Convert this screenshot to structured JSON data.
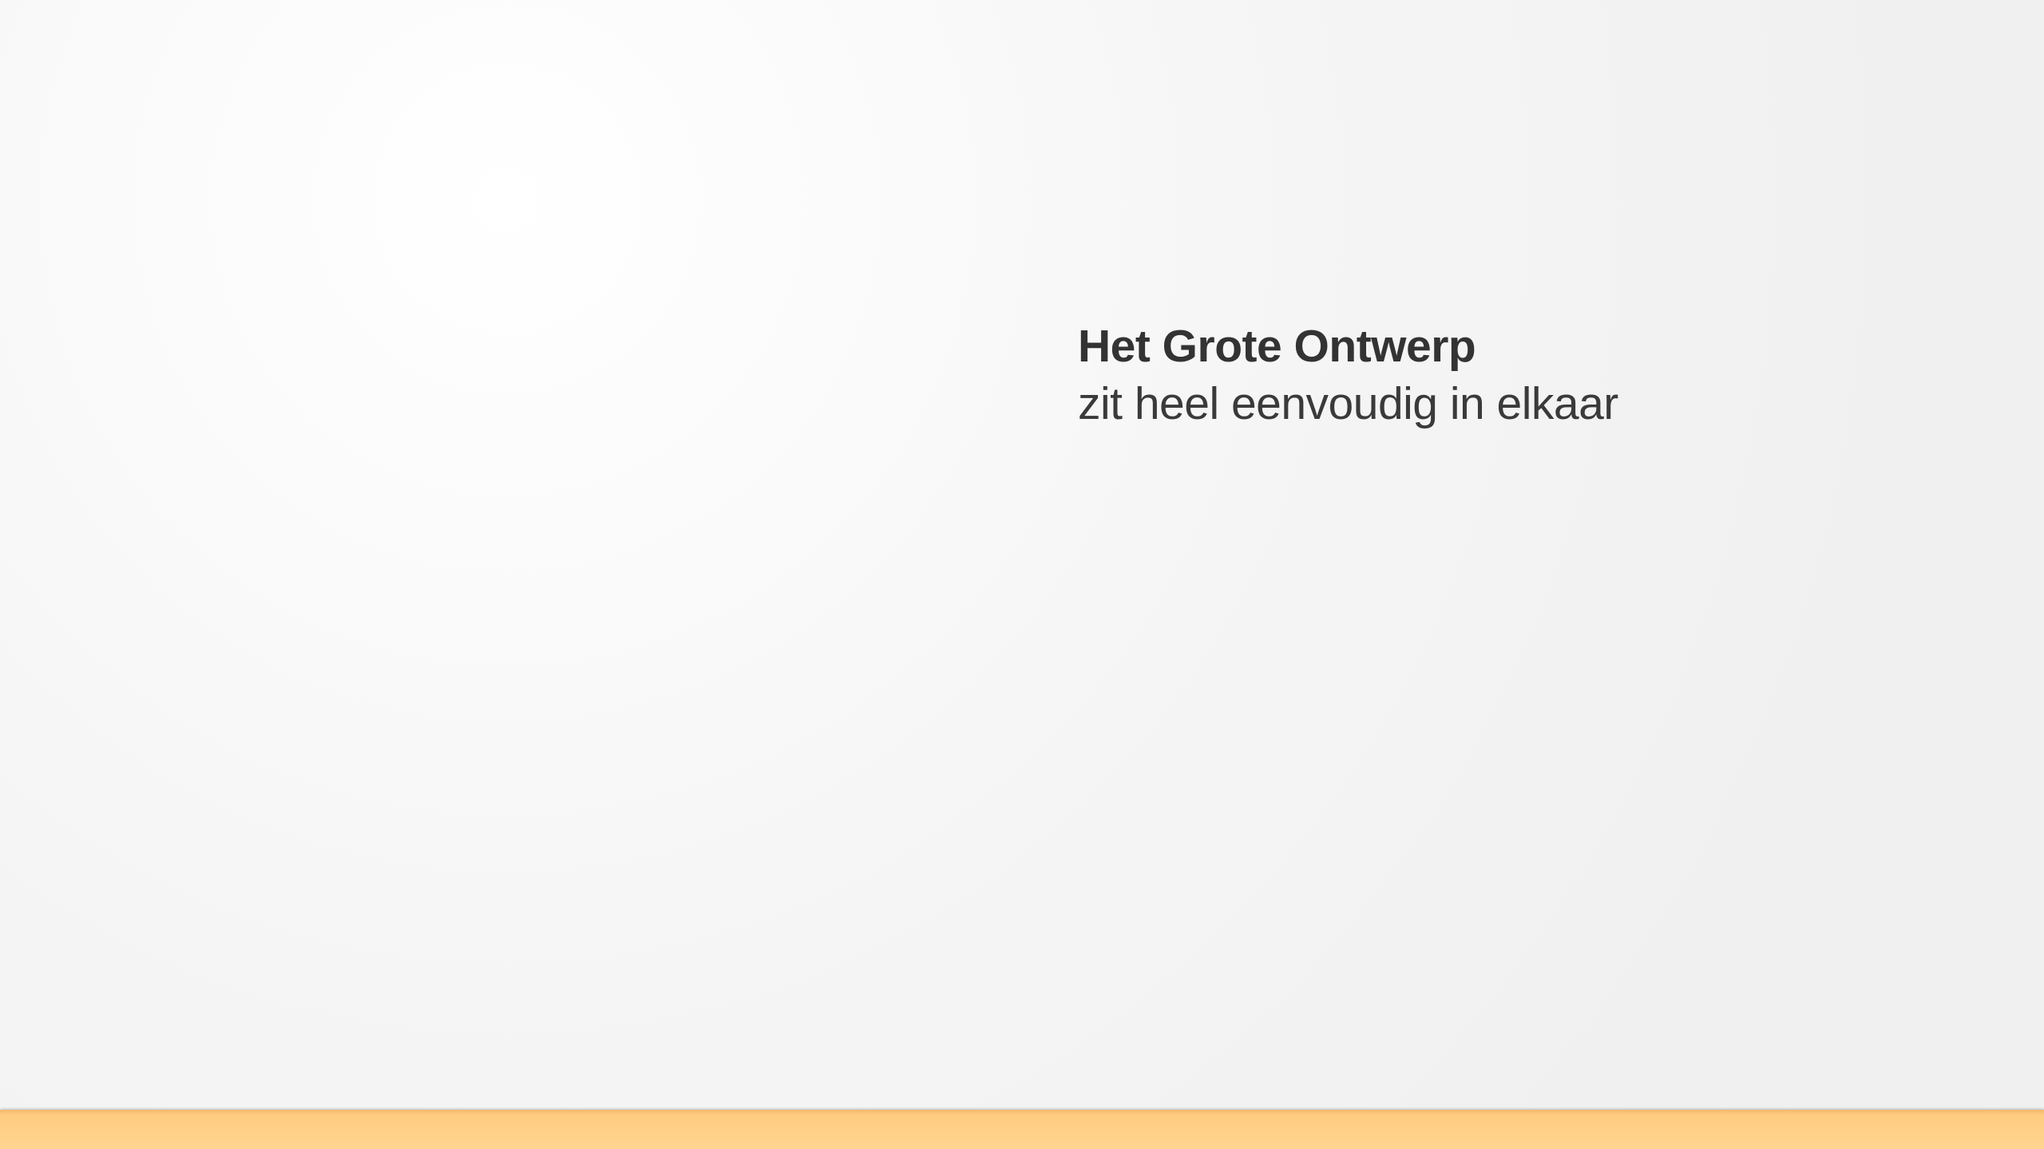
{
  "hero": {
    "title": "Het Grote Ontwerp",
    "subtitle": "zit heel eenvoudig in elkaar"
  },
  "colors": {
    "text": "#333333",
    "accent_bar": "#ffd08a",
    "background": "#f5f5f5"
  }
}
